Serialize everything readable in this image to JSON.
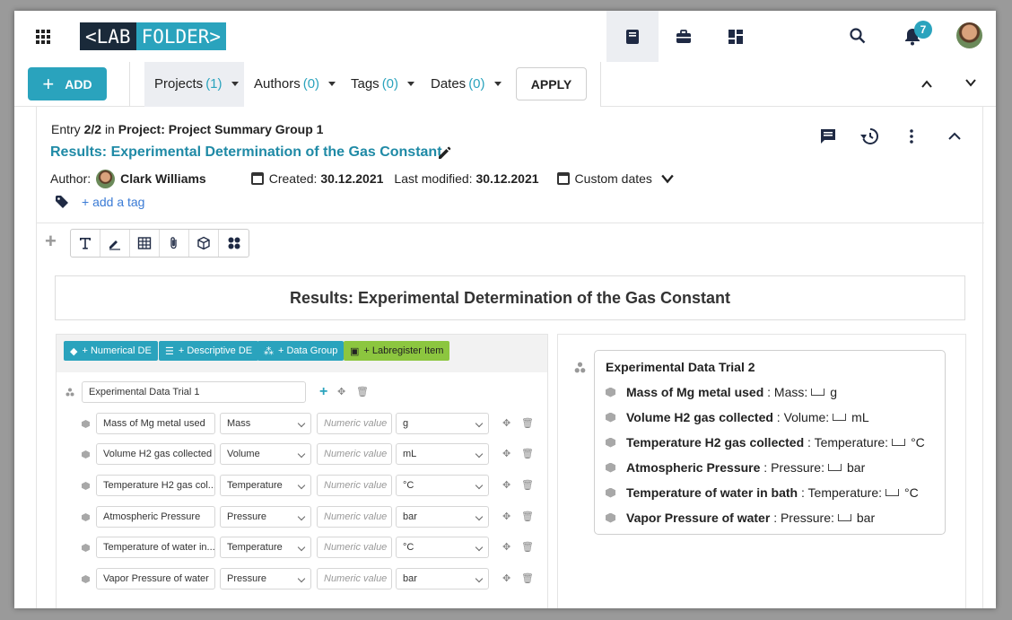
{
  "logo": {
    "left": "<LAB",
    "right": "FOLDER>"
  },
  "notifications_count": "7",
  "toolbar": {
    "add_label": "ADD",
    "filters": [
      {
        "label": "Projects",
        "count": "(1)"
      },
      {
        "label": "Authors",
        "count": "(0)"
      },
      {
        "label": "Tags",
        "count": "(0)"
      },
      {
        "label": "Dates",
        "count": "(0)"
      }
    ],
    "apply_label": "APPLY"
  },
  "entry": {
    "meta_prefix": "Entry",
    "meta_index": "2/2",
    "meta_in": "in",
    "meta_project": "Project: Project Summary Group 1",
    "title": "Results: Experimental Determination of the Gas Constant",
    "author_label": "Author:",
    "author_name": "Clark Williams",
    "created_label": "Created:",
    "created_date": "30.12.2021",
    "modified_label": "Last modified:",
    "modified_date": "30.12.2021",
    "custom_dates": "Custom dates",
    "add_tag": "+ add a tag"
  },
  "text_block": "Results: Experimental Determination of the Gas Constant",
  "data_left": {
    "buttons": [
      "+ Numerical DE",
      "+ Descriptive DE",
      "+ Data Group",
      "+ Labregister Item"
    ],
    "group_name": "Experimental Data Trial 1",
    "rows": [
      {
        "name": "Mass of Mg metal used",
        "quantity": "Mass",
        "value_placeholder": "Numeric value",
        "unit": "g"
      },
      {
        "name": "Volume H2 gas collected",
        "quantity": "Volume",
        "value_placeholder": "Numeric value",
        "unit": "mL"
      },
      {
        "name": "Temperature H2 gas col...",
        "quantity": "Temperature",
        "value_placeholder": "Numeric value",
        "unit": "°C"
      },
      {
        "name": "Atmospheric Pressure",
        "quantity": "Pressure",
        "value_placeholder": "Numeric value",
        "unit": "bar"
      },
      {
        "name": "Temperature of water in...",
        "quantity": "Temperature",
        "value_placeholder": "Numeric value",
        "unit": "°C"
      },
      {
        "name": "Vapor Pressure of water",
        "quantity": "Pressure",
        "value_placeholder": "Numeric value",
        "unit": "bar"
      }
    ]
  },
  "data_right": {
    "title": "Experimental Data Trial 2",
    "rows": [
      {
        "name": "Mass of Mg metal used",
        "quantity": ": Mass:",
        "unit": "g"
      },
      {
        "name": "Volume H2 gas collected",
        "quantity": ": Volume:",
        "unit": "mL"
      },
      {
        "name": "Temperature H2 gas collected",
        "quantity": ": Temperature:",
        "unit": "°C"
      },
      {
        "name": "Atmospheric Pressure",
        "quantity": ": Pressure:",
        "unit": "bar"
      },
      {
        "name": "Temperature of water in bath",
        "quantity": ": Temperature:",
        "unit": "°C"
      },
      {
        "name": "Vapor Pressure of water",
        "quantity": ": Pressure:",
        "unit": "bar"
      }
    ]
  }
}
